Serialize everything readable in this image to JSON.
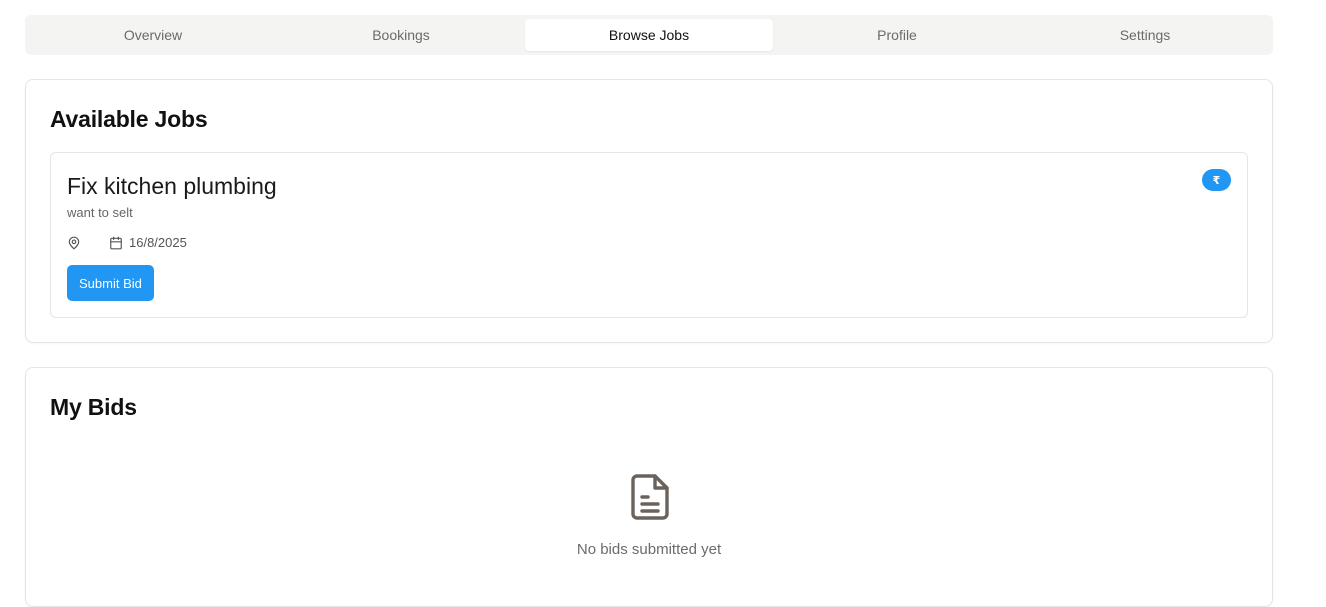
{
  "tabs": [
    {
      "label": "Overview",
      "active": false
    },
    {
      "label": "Bookings",
      "active": false
    },
    {
      "label": "Browse Jobs",
      "active": true
    },
    {
      "label": "Profile",
      "active": false
    },
    {
      "label": "Settings",
      "active": false
    }
  ],
  "available_jobs": {
    "title": "Available Jobs",
    "jobs": [
      {
        "title": "Fix kitchen plumbing",
        "description": "want to selt",
        "location": "",
        "date": "16/8/2025",
        "price_badge": "₹",
        "submit_label": "Submit Bid",
        "icons": {
          "location": "map-pin-icon",
          "date": "calendar-icon"
        }
      }
    ]
  },
  "my_bids": {
    "title": "My Bids",
    "empty_icon": "document-icon",
    "empty_text": "No bids submitted yet"
  },
  "colors": {
    "accent": "#2196f3",
    "tab_bg": "#f4f4f3",
    "border": "#e5e5e3",
    "muted_text": "#6b6b6b"
  }
}
